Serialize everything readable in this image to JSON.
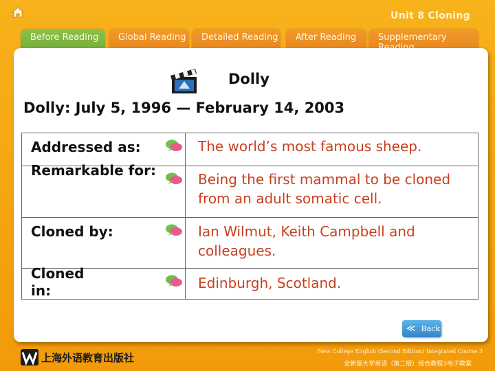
{
  "header": {
    "unit_title": "Unit 8 Cloning"
  },
  "tabs": [
    {
      "label": "Before Reading",
      "active": true
    },
    {
      "label": "Global Reading",
      "active": false
    },
    {
      "label": "Detailed Reading",
      "active": false
    },
    {
      "label": "After Reading",
      "active": false
    },
    {
      "label": "Supplementary Reading",
      "active": false
    }
  ],
  "main": {
    "title": "Dolly",
    "subtitle": "Dolly: July 5, 1996 — February 14, 2003",
    "rows": [
      {
        "label": "Addressed as:",
        "value": "The world’s most famous sheep."
      },
      {
        "label": "Remarkable for:",
        "value": "Being the first mammal to be cloned from an adult somatic cell."
      },
      {
        "label": "Cloned by:",
        "value": "Ian Wilmut, Keith Campbell and colleagues."
      },
      {
        "label": "Cloned in:",
        "value": "Edinburgh, Scotland."
      }
    ],
    "back_label": "Back"
  },
  "footer": {
    "publisher": "上海外语教育出版社",
    "course_en": "New College English (Second Edition) Integrated Course 3",
    "course_cn": "全新版大学英语（第二版）综合教程3电子教案"
  },
  "colors": {
    "background": "#f5a50f",
    "active_tab": "#7ab53c",
    "inactive_tab": "#ec8e22",
    "value_text": "#c8401f",
    "back_button": "#3a8fd0"
  },
  "icons": [
    "home-icon",
    "clapperboard-icon",
    "speech-bubble-icon",
    "back-chevron-icon",
    "publisher-logo"
  ]
}
